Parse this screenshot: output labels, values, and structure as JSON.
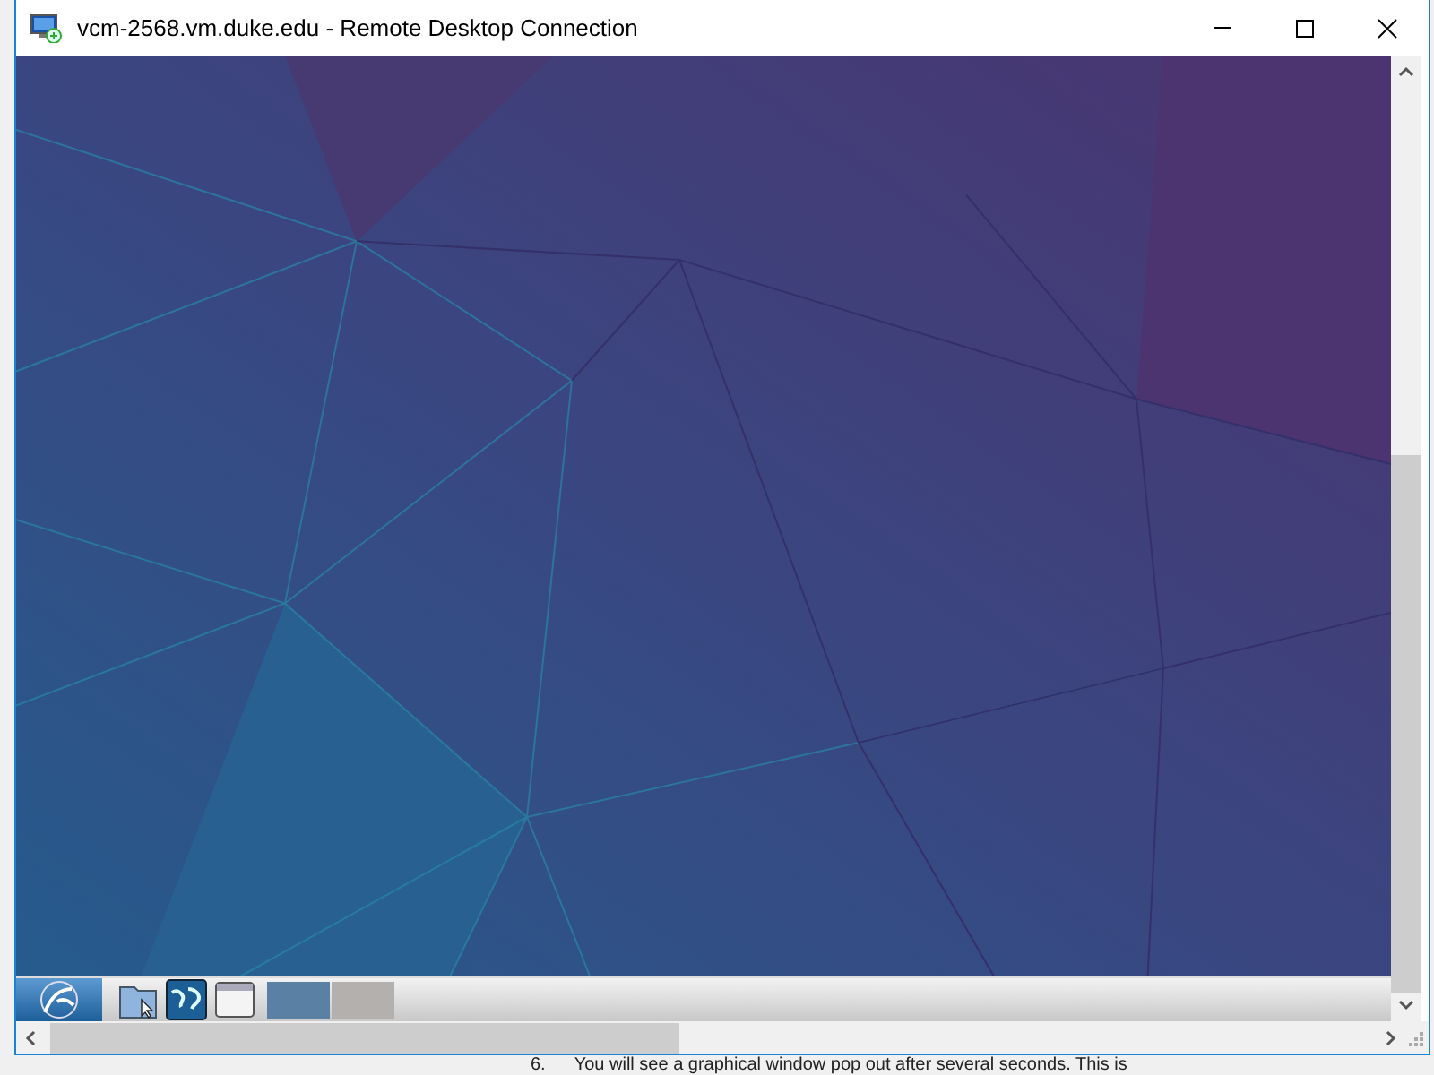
{
  "window": {
    "title": "vcm-2568.vm.duke.edu - Remote Desktop Connection"
  },
  "taskbar": {
    "launchers": [
      {
        "kind": "folder"
      },
      {
        "kind": "globe"
      },
      {
        "kind": "window"
      }
    ],
    "tasks": [
      {
        "selected": true
      },
      {
        "selected": false
      }
    ]
  },
  "background_document": {
    "step_number": "6.",
    "step_text": "You will see a graphical window pop out after several seconds. This is"
  }
}
